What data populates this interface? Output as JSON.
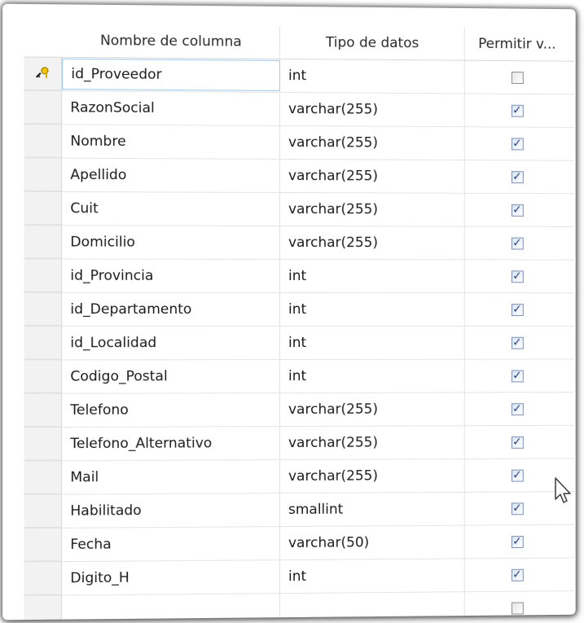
{
  "headers": {
    "name": "Nombre de columna",
    "type": "Tipo de datos",
    "nullable": "Permitir v..."
  },
  "rows": [
    {
      "name": "id_Proveedor",
      "type": "int",
      "allow_nulls": false,
      "primary_key": true
    },
    {
      "name": "RazonSocial",
      "type": "varchar(255)",
      "allow_nulls": true
    },
    {
      "name": "Nombre",
      "type": "varchar(255)",
      "allow_nulls": true
    },
    {
      "name": "Apellido",
      "type": "varchar(255)",
      "allow_nulls": true
    },
    {
      "name": "Cuit",
      "type": "varchar(255)",
      "allow_nulls": true
    },
    {
      "name": "Domicilio",
      "type": "varchar(255)",
      "allow_nulls": true
    },
    {
      "name": "id_Provincia",
      "type": "int",
      "allow_nulls": true
    },
    {
      "name": "id_Departamento",
      "type": "int",
      "allow_nulls": true
    },
    {
      "name": "id_Localidad",
      "type": "int",
      "allow_nulls": true
    },
    {
      "name": "Codigo_Postal",
      "type": "int",
      "allow_nulls": true
    },
    {
      "name": "Telefono",
      "type": "varchar(255)",
      "allow_nulls": true
    },
    {
      "name": "Telefono_Alternativo",
      "type": "varchar(255)",
      "allow_nulls": true
    },
    {
      "name": "Mail",
      "type": "varchar(255)",
      "allow_nulls": true
    },
    {
      "name": "Habilitado",
      "type": "smallint",
      "allow_nulls": true
    },
    {
      "name": "Fecha",
      "type": "varchar(50)",
      "allow_nulls": true
    },
    {
      "name": "Digito_H",
      "type": "int",
      "allow_nulls": true
    },
    {
      "name": "",
      "type": "",
      "allow_nulls": false
    }
  ],
  "icons": {
    "primary_key": "key-icon",
    "checkbox": "checkbox-icon",
    "pointer": "mouse-cursor-icon"
  },
  "colors": {
    "check": "#2d3f7d",
    "active_cell_border": "#9ec7ea"
  }
}
